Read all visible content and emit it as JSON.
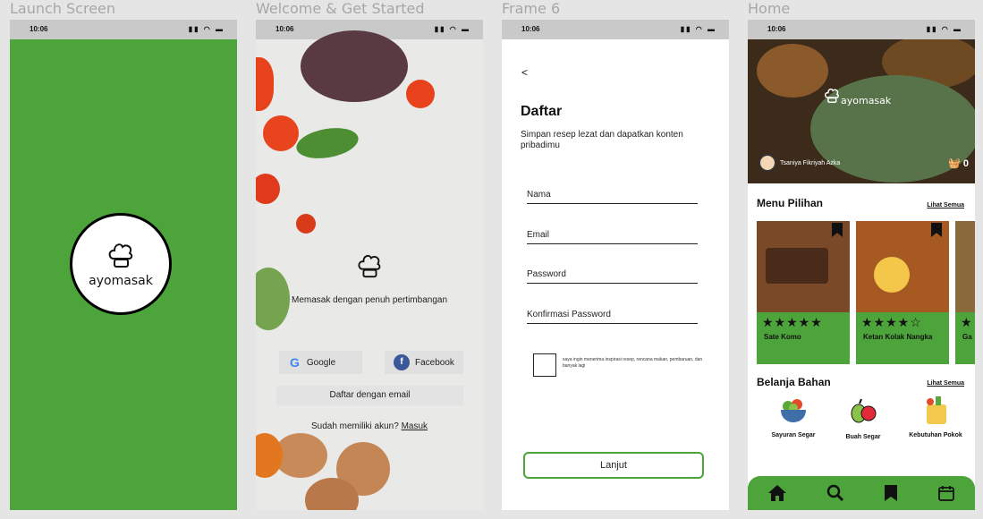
{
  "frames": {
    "launch": "Launch Screen",
    "welcome": "Welcome & Get Started",
    "frame6": "Frame 6",
    "home": "Home"
  },
  "status": {
    "time": "10:06",
    "icons": "▮▮ ◠ ▬"
  },
  "launch": {
    "brand": "ayomasak"
  },
  "welcome": {
    "tagline": "Memasak dengan penuh pertimbangan",
    "google": "Google",
    "facebook": "Facebook",
    "email": "Daftar dengan email",
    "have_account": "Sudah memiliki akun?",
    "login": "Masuk"
  },
  "register": {
    "back": "<",
    "title": "Daftar",
    "subtitle": "Simpan resep lezat dan dapatkan konten pribadimu",
    "fields": [
      "Nama",
      "Email",
      "Password",
      "Konfirmasi Password"
    ],
    "consent": "saya ingin menerima inspirasi resep, rencana makan, pembaruan, dan banyak lagi",
    "submit": "Lanjut"
  },
  "home": {
    "brand": "ayomasak",
    "user": "Tsaniya Fikriyah Azka",
    "cart_count": "0",
    "menu_title": "Menu Pilihan",
    "see_all": "Lihat Semua",
    "cards": [
      {
        "name": "Sate Komo",
        "rating": 5
      },
      {
        "name": "Ketan Kolak Nangka",
        "rating": 4
      },
      {
        "name": "Ga",
        "rating": 1
      }
    ],
    "shop_title": "Belanja Bahan",
    "categories": [
      "Sayuran Segar",
      "Buah Segar",
      "Kebutuhan Pokok"
    ],
    "colors": {
      "green": "#4ca43a"
    }
  }
}
